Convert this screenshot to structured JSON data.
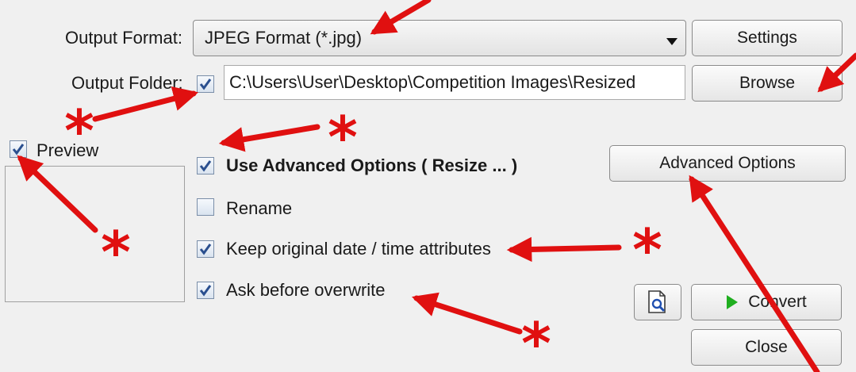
{
  "output_format": {
    "label": "Output Format:",
    "selected": "JPEG Format (*.jpg)",
    "settings_label": "Settings"
  },
  "output_folder": {
    "label": "Output Folder:",
    "checked": true,
    "path": "C:\\Users\\User\\Desktop\\Competition Images\\Resized",
    "browse_label": "Browse"
  },
  "preview": {
    "label": "Preview",
    "checked": true
  },
  "options": {
    "advanced": {
      "label": "Use Advanced Options ( Resize ... )",
      "checked": true
    },
    "rename": {
      "label": "Rename",
      "checked": false
    },
    "keep_attributes": {
      "label": "Keep original date / time attributes",
      "checked": true
    },
    "ask_overwrite": {
      "label": "Ask before overwrite",
      "checked": true
    }
  },
  "buttons": {
    "advanced_options": "Advanced Options",
    "convert": "Convert",
    "close": "Close"
  },
  "icons": {
    "dropdown": "chevron-down-icon",
    "preview_file": "magnifier-document-icon",
    "convert": "play-icon"
  },
  "colors": {
    "annotation_red": "#e01010",
    "checkmark_blue": "#2a4f8f",
    "convert_green": "#1fae1f"
  }
}
